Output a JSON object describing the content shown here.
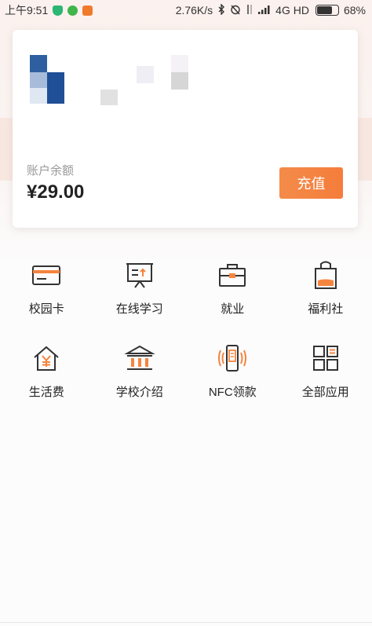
{
  "status_bar": {
    "time": "上午9:51",
    "net_speed": "2.76K/s",
    "network": "4G HD",
    "battery_percent": "68%",
    "battery_level": 0.68,
    "icons": [
      "shield-app-icon",
      "wechat-icon",
      "app-notify-icon",
      "bluetooth-icon",
      "alarm-off-icon",
      "data-arrows-icon",
      "signal-icon",
      "battery-icon"
    ]
  },
  "card": {
    "logo_text": "",
    "balance_label": "账户余额",
    "balance_amount": "¥29.00",
    "recharge_label": "充值"
  },
  "colors": {
    "accent": "#f5843f",
    "icon_dark": "#333333",
    "logo_blue": "#2e5fa0"
  },
  "grid": {
    "row1": [
      {
        "label": "校园卡",
        "icon": "card-icon"
      },
      {
        "label": "在线学习",
        "icon": "presentation-icon"
      },
      {
        "label": "就业",
        "icon": "briefcase-icon"
      },
      {
        "label": "福利社",
        "icon": "shopping-bag-icon"
      }
    ],
    "row2": [
      {
        "label": "生活费",
        "icon": "yuan-house-icon"
      },
      {
        "label": "学校介绍",
        "icon": "school-building-icon"
      },
      {
        "label": "NFC领款",
        "icon": "nfc-phone-icon"
      },
      {
        "label": "全部应用",
        "icon": "apps-grid-icon"
      }
    ]
  }
}
